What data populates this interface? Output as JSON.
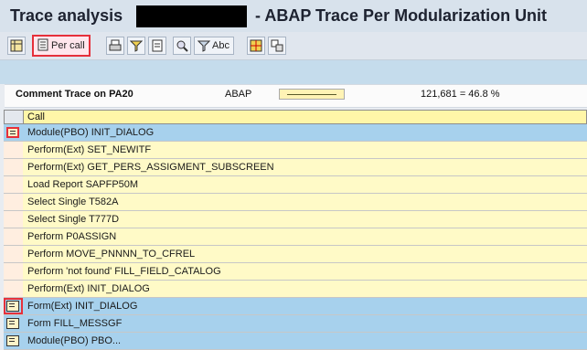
{
  "window": {
    "title_left": "Trace analysis",
    "title_right": "- ABAP Trace Per Modularization Unit"
  },
  "toolbar": {
    "per_call_label": "Per call",
    "abc_label": "Abc"
  },
  "summary": {
    "label": "Comment Trace on PA20",
    "kind": "ABAP",
    "value_text": "121,681  =  46.8 %",
    "percent": 46.8
  },
  "table": {
    "header": "Call",
    "rows": [
      {
        "text": "Module(PBO) INIT_DIALOG",
        "highlight": true
      },
      {
        "text": "Perform(Ext) SET_NEWITF",
        "highlight": false
      },
      {
        "text": "Perform(Ext) GET_PERS_ASSIGMENT_SUBSCREEN",
        "highlight": false
      },
      {
        "text": "Load Report SAPFP50M",
        "highlight": false
      },
      {
        "text": "Select Single T582A",
        "highlight": false
      },
      {
        "text": "Select Single T777D",
        "highlight": false
      },
      {
        "text": "Perform P0ASSIGN",
        "highlight": false
      },
      {
        "text": "Perform MOVE_PNNNN_TO_CFREL",
        "highlight": false
      },
      {
        "text": "Perform 'not found' FILL_FIELD_CATALOG",
        "highlight": false
      },
      {
        "text": "Perform(Ext) INIT_DIALOG",
        "highlight": false
      },
      {
        "text": "Form(Ext) INIT_DIALOG",
        "highlight": true
      },
      {
        "text": "Form FILL_MESSGF",
        "highlight": true
      },
      {
        "text": "Module(PBO) PBO...",
        "highlight": true
      }
    ]
  },
  "colors": {
    "selection_blue": "#a7d1ed",
    "row_yellow": "#fffac7",
    "accent_red": "#e6303a"
  }
}
